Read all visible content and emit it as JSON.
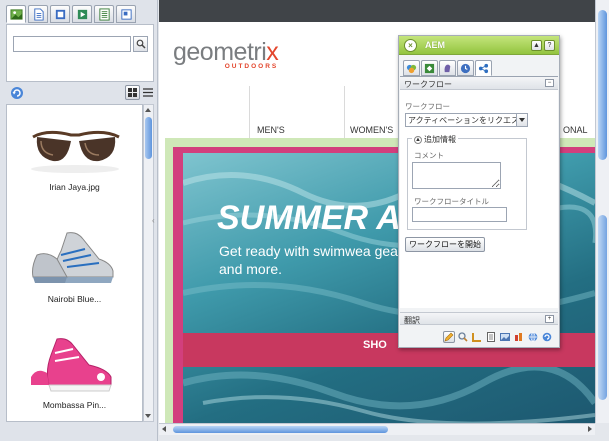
{
  "finder": {
    "tabs": [
      "image-tab-icon",
      "document-tab-icon",
      "movie-tab-icon",
      "flash-tab-icon",
      "page-tab-icon",
      "paragraph-tab-icon"
    ],
    "search": {
      "value": "",
      "placeholder": ""
    },
    "items": [
      {
        "caption": "Irian Jaya.jpg",
        "icon": "sunglasses-image"
      },
      {
        "caption": "Nairobi Blue...",
        "icon": "sneaker-image"
      },
      {
        "caption": "Mombassa Pin...",
        "icon": "pink-sneaker-image"
      }
    ]
  },
  "page": {
    "logo_word": "geometri",
    "logo_x": "x",
    "logo_sub": "OUTDOORS",
    "nav": [
      "MEN'S",
      "WOMEN'S",
      "ONAL"
    ],
    "hero_title": "SUMMER A",
    "hero_sub": "Get ready with swimwea gear and more.",
    "hero_shop": "SHO"
  },
  "sidekick": {
    "title": "AEM",
    "section_title": "ワークフロー",
    "workflow_label": "ワークフロー",
    "workflow_value": "アクティベーションをリクエス",
    "extra_label": "追加情報",
    "comment_label": "コメント",
    "title_label": "ワークフロータイトル",
    "start_button": "ワークフローを開始",
    "translate_label": "翻訳"
  },
  "colors": {
    "accent_green": "#93c43f",
    "hero_pink": "#d23f7d",
    "logo_orange": "#e3462d"
  }
}
